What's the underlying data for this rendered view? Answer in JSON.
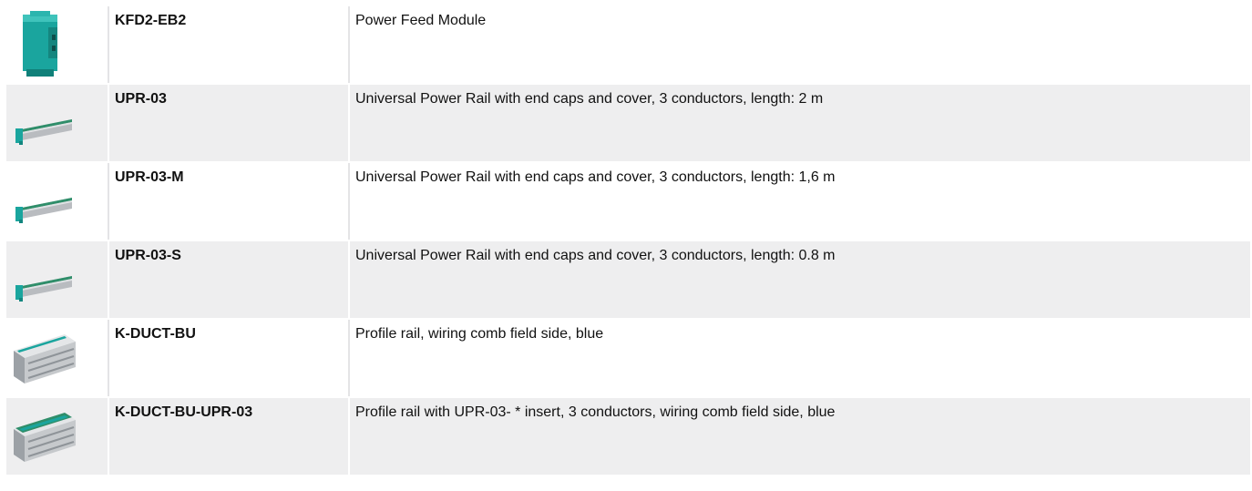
{
  "accessories": [
    {
      "product": "KFD2-EB2",
      "description": "Power Feed Module",
      "image_icon": "power-feed-module-icon"
    },
    {
      "product": "UPR-03",
      "description": "Universal Power Rail with end caps and cover, 3 conductors, length: 2 m",
      "image_icon": "power-rail-icon"
    },
    {
      "product": "UPR-03-M",
      "description": "Universal Power Rail with end caps and cover, 3 conductors, length: 1,6 m",
      "image_icon": "power-rail-icon"
    },
    {
      "product": "UPR-03-S",
      "description": "Universal Power Rail with end caps and cover, 3 conductors, length: 0.8 m",
      "image_icon": "power-rail-icon"
    },
    {
      "product": "K-DUCT-BU",
      "description": "Profile rail, wiring comb field side, blue",
      "image_icon": "profile-rail-icon"
    },
    {
      "product": "K-DUCT-BU-UPR-03",
      "description": "Profile rail with UPR-03- * insert, 3 conductors, wiring comb field side, blue",
      "image_icon": "profile-rail-insert-icon"
    }
  ],
  "colors": {
    "row_alt": "#eeeeef",
    "module_teal": "#1aa59e",
    "rail_gray": "#b9bcc0"
  }
}
